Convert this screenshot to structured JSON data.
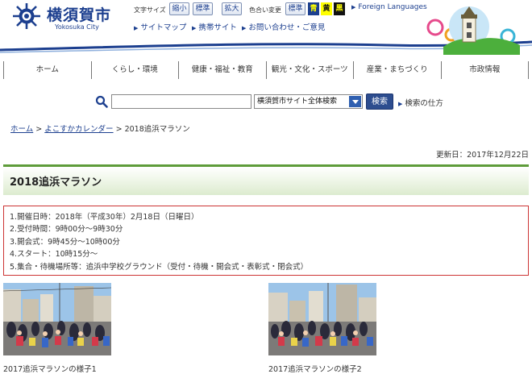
{
  "header": {
    "city_name": "横須賀市",
    "city_sub": "Yokosuka City",
    "font_size_label": "文字サイズ",
    "font_buttons": [
      "縮小",
      "標準",
      "拡大"
    ],
    "color_label": "色合い変更",
    "color_buttons": {
      "standard": "標準",
      "blue": "青",
      "yellow": "黄",
      "black": "黒"
    },
    "foreign_languages": "Foreign Languages",
    "links": [
      "サイトマップ",
      "携帯サイト",
      "お問い合わせ・ご意見"
    ]
  },
  "nav": {
    "items": [
      "ホーム",
      "くらし・環境",
      "健康・福祉・教育",
      "観光・文化・スポーツ",
      "産業・まちづくり",
      "市政情報"
    ]
  },
  "search": {
    "input_value": "",
    "scope": "横須賀市サイト全体検索",
    "button": "検索",
    "help": "検索の仕方"
  },
  "breadcrumb": {
    "home": "ホーム",
    "sep1": ">",
    "calendar": "よこすかカレンダー",
    "sep2": ">",
    "current": "2018追浜マラソン"
  },
  "updated": "更新日：2017年12月22日",
  "page_title": "2018追浜マラソン",
  "info": [
    "1.開催日時：2018年（平成30年）2月18日（日曜日）",
    "2.受付時間：9時00分～9時30分",
    "3.開会式：9時45分～10時00分",
    "4.スタート：10時15分～",
    "5.集合・待機場所等：追浜中学校グラウンド（受付・待機・開会式・表彰式・閉会式）"
  ],
  "photos": [
    {
      "caption": "2017追浜マラソンの様子1"
    },
    {
      "caption": "2017追浜マラソンの様子2"
    }
  ],
  "colors": {
    "brand": "#1c3f8f",
    "title_accent": "#5e9c3a",
    "info_border": "#cc3333",
    "search_button": "#2d4d8f"
  }
}
